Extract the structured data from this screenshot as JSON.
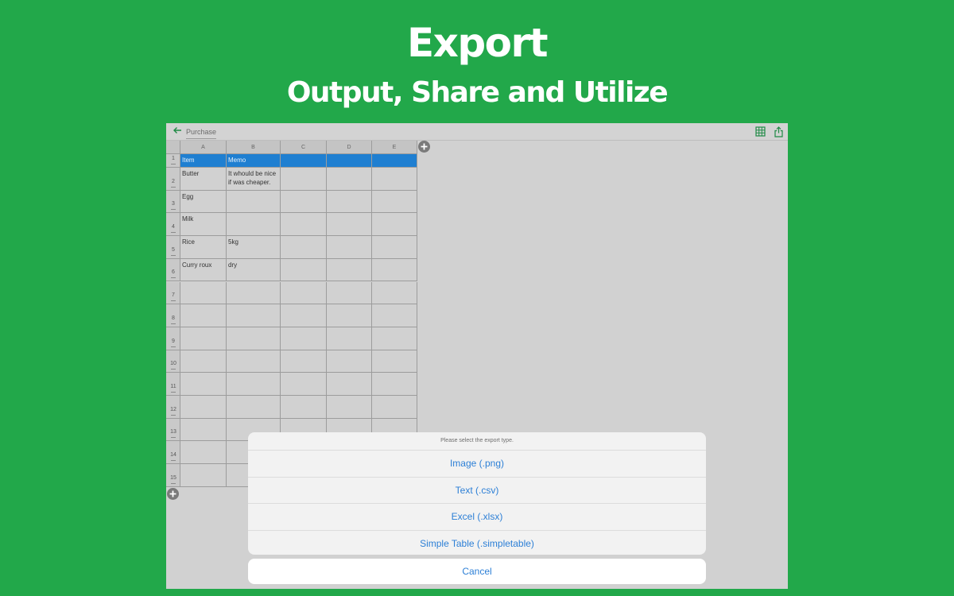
{
  "promo": {
    "title": "Export",
    "subtitle": "Output, Share and Utilize"
  },
  "navbar": {
    "back_icon": "arrow-left-icon",
    "title": "Purchase",
    "grid_icon": "grid-icon",
    "share_icon": "share-icon",
    "accent": "#1f8a45"
  },
  "sheet": {
    "columns": [
      "A",
      "B",
      "C",
      "D",
      "E"
    ],
    "rows": [
      {
        "num": "1",
        "cells": [
          "Item",
          "Memo",
          "",
          "",
          ""
        ]
      },
      {
        "num": "2",
        "cells": [
          "Butter",
          "It whould be nice if was cheaper.",
          "",
          "",
          ""
        ]
      },
      {
        "num": "3",
        "cells": [
          "Egg",
          "",
          "",
          "",
          ""
        ]
      },
      {
        "num": "4",
        "cells": [
          "Milk",
          "",
          "",
          "",
          ""
        ]
      },
      {
        "num": "5",
        "cells": [
          "Rice",
          "5kg",
          "",
          "",
          ""
        ]
      },
      {
        "num": "6",
        "cells": [
          "Curry roux",
          "dry",
          "",
          "",
          ""
        ]
      },
      {
        "num": "7",
        "cells": [
          "",
          "",
          "",
          "",
          ""
        ]
      },
      {
        "num": "8",
        "cells": [
          "",
          "",
          "",
          "",
          ""
        ]
      },
      {
        "num": "9",
        "cells": [
          "",
          "",
          "",
          "",
          ""
        ]
      },
      {
        "num": "10",
        "cells": [
          "",
          "",
          "",
          "",
          ""
        ]
      },
      {
        "num": "11",
        "cells": [
          "",
          "",
          "",
          "",
          ""
        ]
      },
      {
        "num": "12",
        "cells": [
          "",
          "",
          "",
          "",
          ""
        ]
      },
      {
        "num": "13",
        "cells": [
          "",
          "",
          "",
          "",
          ""
        ]
      },
      {
        "num": "14",
        "cells": [
          "",
          "",
          "",
          "",
          ""
        ]
      },
      {
        "num": "15",
        "cells": [
          "",
          "",
          "",
          "",
          ""
        ]
      }
    ],
    "header_color": "#1f7fd1",
    "add_column_icon": "plus-icon",
    "add_row_icon": "plus-icon"
  },
  "export_dialog": {
    "message": "Please select the export type.",
    "options": [
      "Image (.png)",
      "Text (.csv)",
      "Excel (.xlsx)",
      "Simple Table (.simpletable)"
    ],
    "cancel_label": "Cancel",
    "link_color": "#2c7fd6"
  }
}
